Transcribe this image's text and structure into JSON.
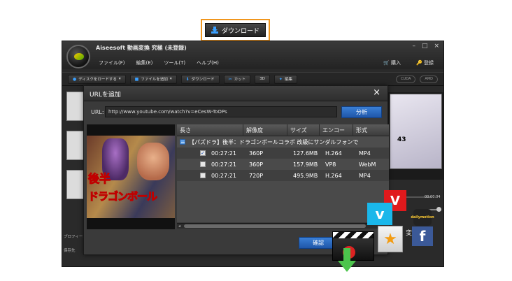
{
  "callout": {
    "label": "ダウンロード"
  },
  "app": {
    "title": "Aiseesoft 動画変換 究極 (未登録)",
    "window_controls": [
      "–",
      "□",
      "×"
    ],
    "menu": [
      "ファイル(F)",
      "編集(E)",
      "ツール(T)",
      "ヘルプ(H)"
    ],
    "menu_right": [
      "購入",
      "登録"
    ],
    "toolbar": {
      "disc_load": "ディスクをロードする",
      "add_file": "ファイルを追加",
      "download": "ダウンロード",
      "cut": "カット",
      "three_d": "3D",
      "edit": "編集",
      "cuda": "CUDA",
      "amd": "AMD"
    },
    "left_labels": [
      "プロフィール",
      "保存先"
    ],
    "preview": {
      "number": "43",
      "time": "00:00:04"
    },
    "convert_label": "変換"
  },
  "dialog": {
    "title": "URLを追加",
    "close": "×",
    "url_label": "URL:",
    "url_value": "http://www.youtube.com/watch?v=eCesW-ToOPs",
    "analyze": "分析",
    "confirm": "確認",
    "columns": [
      "長さ",
      "解像度",
      "サイズ",
      "エンコー",
      "形式"
    ],
    "video_title": "【パズドラ】後半：ドラゴンボールコラボ 改級にサンダルフォンで",
    "rows": [
      {
        "checked": true,
        "check_mark": "✓",
        "duration": "00:27:21",
        "resolution": "360P",
        "size": "127.6MB",
        "encoder": "H.264",
        "format": "MP4"
      },
      {
        "checked": false,
        "check_mark": "",
        "duration": "00:27:21",
        "resolution": "360P",
        "size": "157.9MB",
        "encoder": "VP8",
        "format": "WebM"
      },
      {
        "checked": false,
        "check_mark": "",
        "duration": "00:27:21",
        "resolution": "720P",
        "size": "495.9MB",
        "encoder": "H.264",
        "format": "MP4"
      }
    ],
    "thumbnail_text": [
      "後半",
      "ドラゴンボール"
    ]
  },
  "logos": {
    "vimeo": "v",
    "vevo": "V",
    "dailymotion": "dailymotion",
    "facebook": "f",
    "star": "★"
  },
  "colors": {
    "callout_border": "#f0961e",
    "accent_blue": "#2a6cc4",
    "vimeo": "#1ab7ea",
    "vevo": "#e0191c",
    "facebook": "#3b5998",
    "download_arrow": "#4cc44c"
  }
}
